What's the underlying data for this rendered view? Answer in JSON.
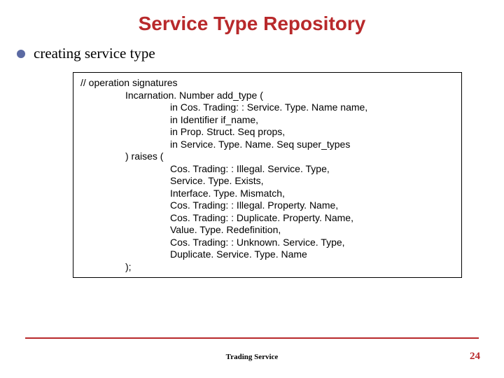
{
  "title": "Service Type Repository",
  "bullet": "creating service type",
  "code": {
    "comment": "// operation signatures",
    "decl": "Incarnation. Number add_type (",
    "params": [
      "in Cos. Trading: : Service. Type. Name name,",
      "in Identifier if_name,",
      "in Prop. Struct. Seq props,",
      "in Service. Type. Name. Seq super_types"
    ],
    "raises": ") raises (",
    "exceptions": [
      "Cos. Trading: : Illegal. Service. Type,",
      "Service. Type. Exists,",
      "Interface. Type. Mismatch,",
      "Cos. Trading: : Illegal. Property. Name,",
      "Cos. Trading: : Duplicate. Property. Name,",
      "Value. Type. Redefinition,",
      "Cos. Trading: : Unknown. Service. Type,",
      "Duplicate. Service. Type. Name"
    ],
    "close": ");"
  },
  "footer": "Trading Service",
  "page": "24"
}
